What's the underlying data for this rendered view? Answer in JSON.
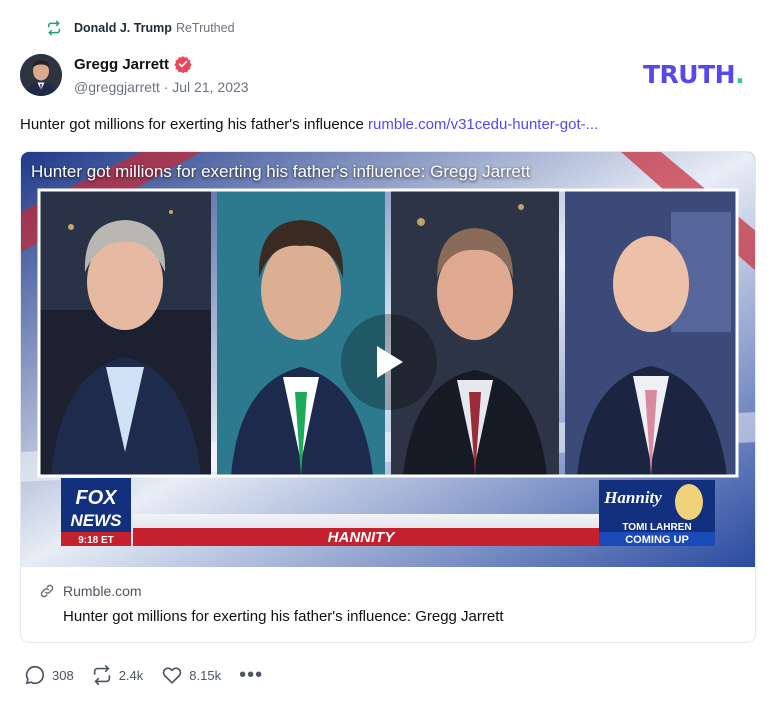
{
  "retruth_banner": {
    "user": "Donald J. Trump",
    "verb": "ReTruthed",
    "icon": "retruth-icon"
  },
  "author": {
    "name": "Gregg Jarrett",
    "handle": "@greggjarrett",
    "date": "Jul 21, 2023",
    "verified_icon": "verified-badge-icon",
    "verified_color": "#e8485a"
  },
  "brand": {
    "text": "TRUTH",
    "dot": ".",
    "color": "#5448ee",
    "dot_color": "#2ec8a5"
  },
  "post": {
    "text": "Hunter got millions for exerting his father's influence",
    "link_text": "rumble.com/v31cedu-hunter-got-..."
  },
  "media": {
    "video_title": "Hunter got millions for exerting his father's influence: Gregg Jarrett",
    "play_icon": "play-icon",
    "network_logo_top": "FOX",
    "network_logo_bottom": "NEWS",
    "clock": "9:18 ET",
    "show_name": "HANNITY",
    "promo_logo": "Hannity",
    "promo_line1": "TOMI LAHREN",
    "promo_line2": "COMING UP"
  },
  "link_card": {
    "domain": "Rumble.com",
    "title": "Hunter got millions for exerting his father's influence: Gregg Jarrett",
    "icon": "link-icon"
  },
  "actions": {
    "replies": "308",
    "retruths": "2.4k",
    "likes": "8.15k",
    "more": "•••"
  }
}
